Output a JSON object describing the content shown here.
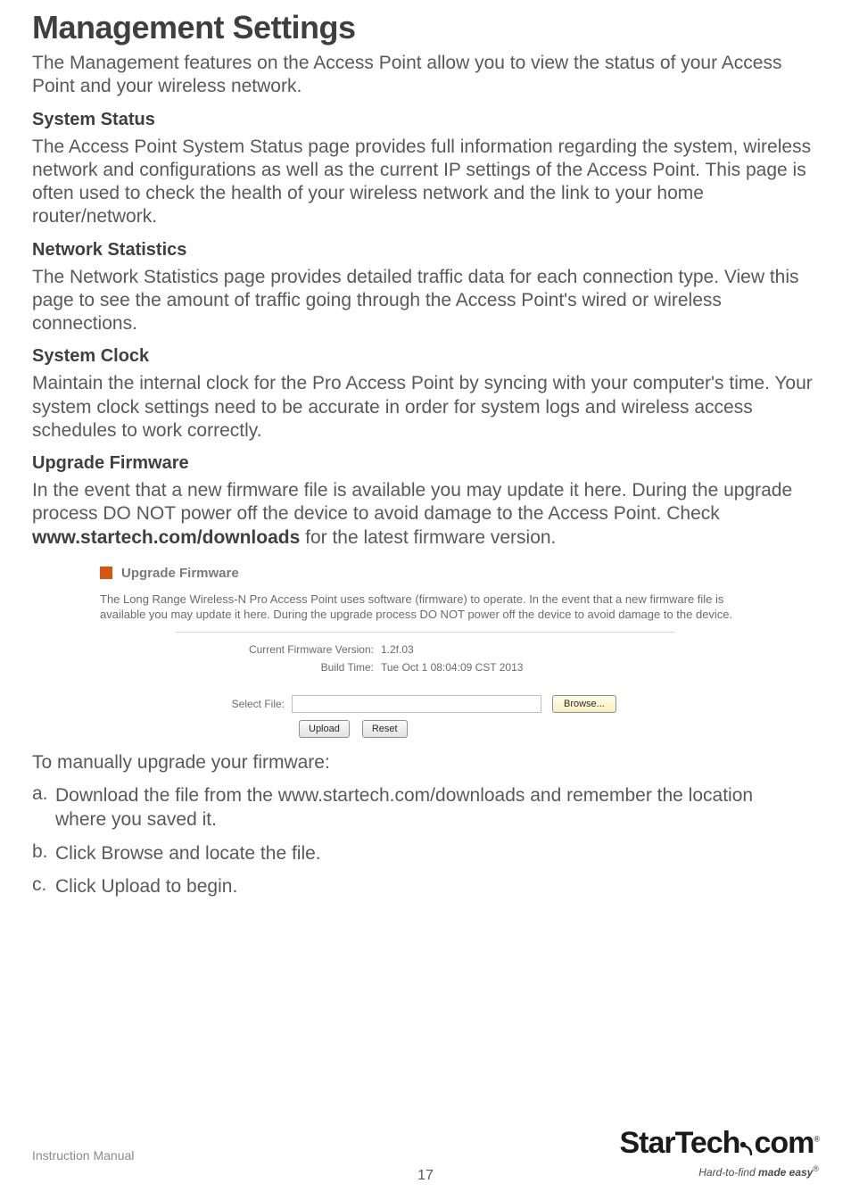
{
  "title": "Management Settings",
  "intro": "The Management features on the Access Point allow you to view the status of your Access Point and your wireless network.",
  "sections": {
    "status": {
      "heading": "System Status",
      "body": "The Access Point System Status page provides full information regarding the system, wireless network and configurations as well as the current IP settings of the Access Point. This page is often used to check the health of your wireless network and the link to your home router/network."
    },
    "stats": {
      "heading": "Network Statistics",
      "body": "The Network Statistics page provides detailed traffic data for each connection type. View this page to see the amount of traffic going through the Access Point's wired or wireless connections."
    },
    "clock": {
      "heading": "System Clock",
      "body": "Maintain the internal clock for the Pro Access Point by syncing with your computer's time. Your system clock settings need to be accurate in order for system logs and wireless access schedules to work correctly."
    },
    "upgrade": {
      "heading": "Upgrade Firmware",
      "body_pre": "In the event that a new firmware file is available you may update it here. During the upgrade process DO NOT power off the device to avoid damage to the Access Point. Check ",
      "body_bold": "www.startech.com/downloads",
      "body_post": " for the latest firmware version."
    }
  },
  "fw_panel": {
    "title": "Upgrade Firmware",
    "desc": "The Long Range Wireless-N Pro Access Point uses software (firmware) to operate. In the event that a new firmware file is available you may update it here. During the upgrade process DO NOT power off the device to avoid damage to the device.",
    "version_label": "Current Firmware Version:",
    "version_value": "1.2f.03",
    "build_label": "Build Time:",
    "build_value": "Tue Oct 1 08:04:09 CST 2013",
    "select_label": "Select File:",
    "file_value": "",
    "browse": "Browse...",
    "upload": "Upload",
    "reset": "Reset"
  },
  "manual_intro": "To manually upgrade your firmware:",
  "steps": {
    "a": {
      "marker": "a.",
      "text": "Download the file from the www.startech.com/downloads and remember the location where you saved it."
    },
    "b": {
      "marker": "b.",
      "text": "Click Browse and locate the file."
    },
    "c": {
      "marker": "c.",
      "text": "Click Upload to begin."
    }
  },
  "footer": {
    "label": "Instruction Manual",
    "page": "17",
    "logo_main": "StarTech",
    "logo_suffix": "com",
    "tag_pre": "Hard-to-find ",
    "tag_strong": "made easy"
  }
}
